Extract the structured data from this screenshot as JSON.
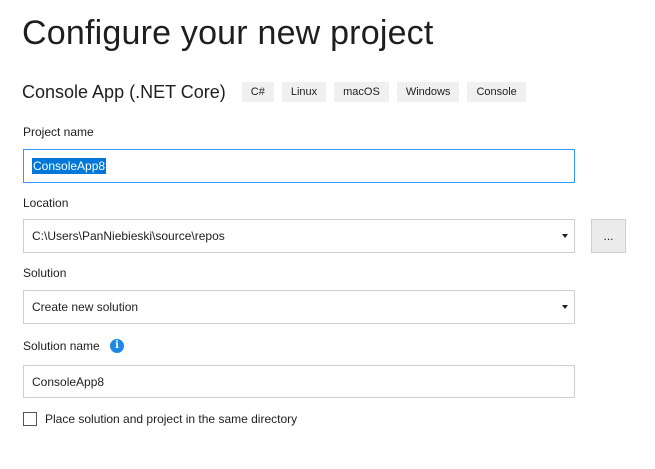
{
  "header": {
    "title": "Configure your new project"
  },
  "template": {
    "name": "Console App (.NET Core)",
    "tags": [
      "C#",
      "Linux",
      "macOS",
      "Windows",
      "Console"
    ]
  },
  "project_name": {
    "label": "Project name",
    "value": "ConsoleApp8"
  },
  "location": {
    "label": "Location",
    "value": "C:\\Users\\PanNiebieski\\source\\repos",
    "browse_label": "..."
  },
  "solution": {
    "label": "Solution",
    "value": "Create new solution"
  },
  "solution_name": {
    "label": "Solution name",
    "info_glyph": "i",
    "value": "ConsoleApp8"
  },
  "same_directory": {
    "label": "Place solution and project in the same directory",
    "checked": false
  },
  "colors": {
    "focus_border": "#3399ff",
    "selection": "#0078d7",
    "info_icon": "#1e88e5",
    "tag_background": "#f0f0f0"
  }
}
